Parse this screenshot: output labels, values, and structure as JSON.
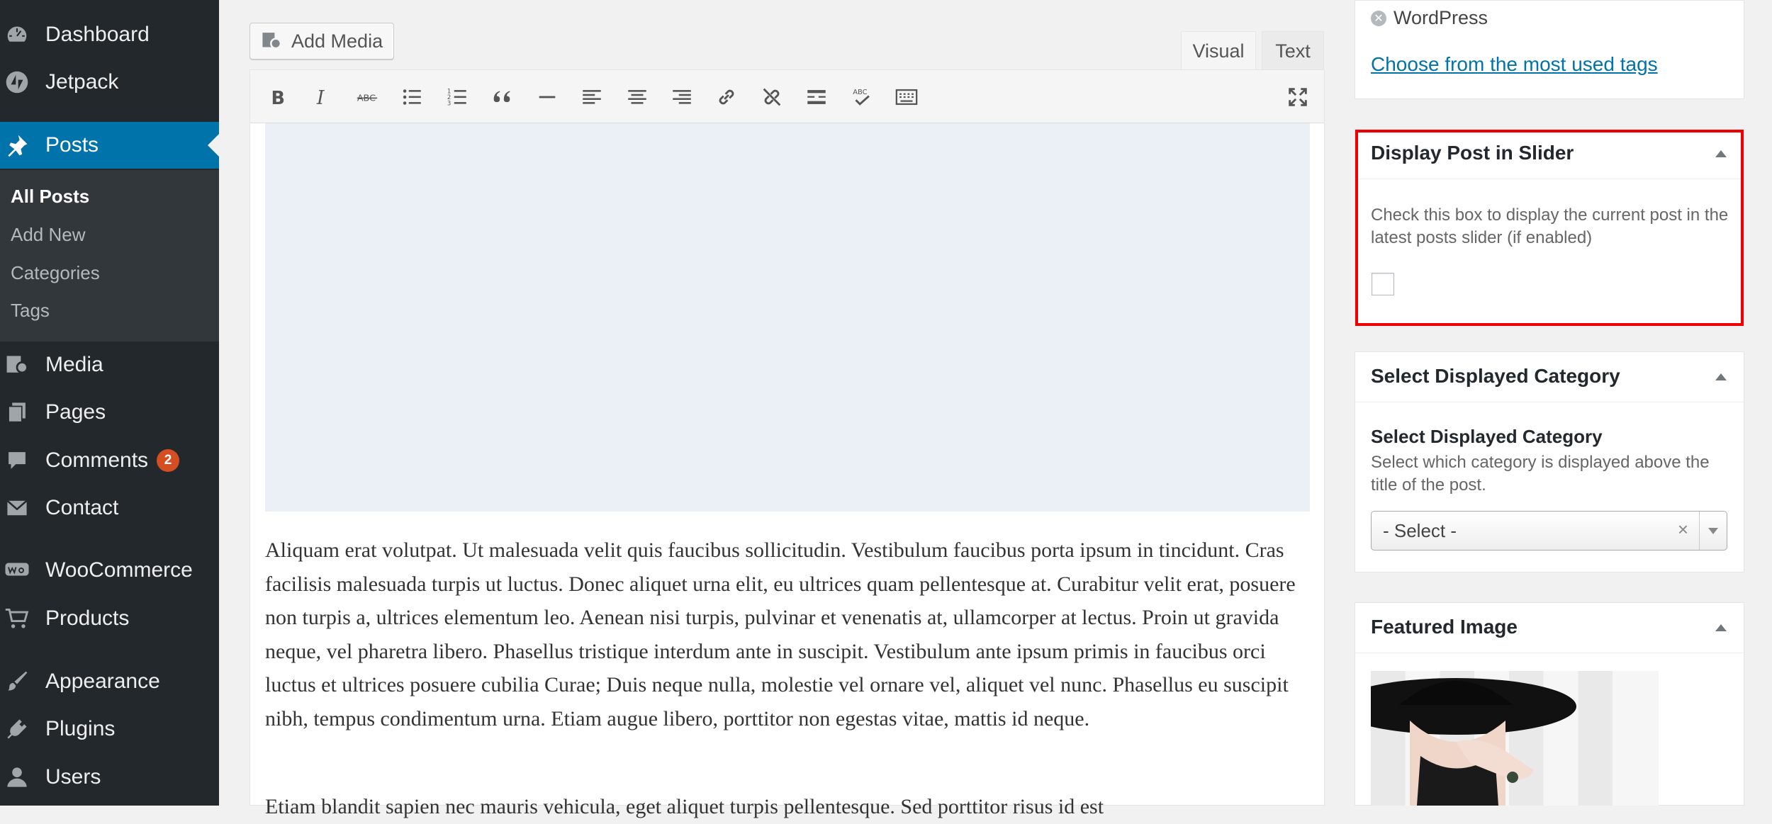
{
  "sidebar": {
    "items": [
      {
        "label": "Dashboard",
        "icon": "dashboard-icon"
      },
      {
        "label": "Jetpack",
        "icon": "jetpack-icon"
      },
      {
        "label": "Posts",
        "icon": "pin-icon",
        "active": true
      },
      {
        "label": "Media",
        "icon": "media-icon"
      },
      {
        "label": "Pages",
        "icon": "pages-icon"
      },
      {
        "label": "Comments",
        "icon": "comments-icon",
        "badge": "2"
      },
      {
        "label": "Contact",
        "icon": "mail-icon"
      },
      {
        "label": "WooCommerce",
        "icon": "woocommerce-icon"
      },
      {
        "label": "Products",
        "icon": "cart-icon"
      },
      {
        "label": "Appearance",
        "icon": "paintbrush-icon"
      },
      {
        "label": "Plugins",
        "icon": "plugin-icon"
      },
      {
        "label": "Users",
        "icon": "user-icon"
      }
    ],
    "submenu": [
      "All Posts",
      "Add New",
      "Categories",
      "Tags"
    ],
    "colors": {
      "background": "#23282d",
      "submenu_bg": "#32373c",
      "active": "#0073aa",
      "badge": "#d54e21"
    }
  },
  "editor": {
    "add_media_label": "Add Media",
    "tabs": {
      "visual": "Visual",
      "text": "Text"
    },
    "toolbar_icons": [
      "bold-icon",
      "italic-icon",
      "strikethrough-icon",
      "bullet-list-icon",
      "numbered-list-icon",
      "blockquote-icon",
      "horizontal-rule-icon",
      "align-left-icon",
      "align-center-icon",
      "align-right-icon",
      "link-icon",
      "unlink-icon",
      "read-more-icon",
      "spellcheck-icon",
      "toolbar-toggle-icon",
      "fullscreen-icon"
    ],
    "paragraphs": [
      "Aliquam erat volutpat. Ut malesuada velit quis faucibus sollicitudin. Vestibulum faucibus porta ipsum in tincidunt. Cras facilisis malesuada turpis ut luctus. Donec aliquet urna elit, eu ultrices quam pellentesque at. Curabitur velit erat, posuere non turpis a, ultrices elementum leo. Aenean nisi turpis, pulvinar et venenatis at, ullamcorper at lectus. Proin ut gravida neque, vel pharetra libero. Phasellus tristique interdum ante in suscipit. Vestibulum ante ipsum primis in faucibus orci luctus et ultrices posuere cubilia Curae; Duis neque nulla, molestie vel ornare vel, aliquet vel nunc. Phasellus eu suscipit nibh, tempus condimentum urna. Etiam augue libero, porttitor non egestas vitae, mattis id neque.",
      "Etiam blandit sapien nec mauris vehicula, eget aliquet turpis pellentesque. Sed porttitor risus id est"
    ]
  },
  "tags_box": {
    "tag": "WordPress",
    "choose_link": "Choose from the most used tags"
  },
  "slider_box": {
    "title": "Display Post in Slider",
    "description": "Check this box to display the current post in the latest posts slider (if enabled)",
    "checked": false,
    "highlight_color": "#ee0000"
  },
  "category_box": {
    "title": "Select Displayed Category",
    "field_label": "Select Displayed Category",
    "description": "Select which category is displayed above the title of the post.",
    "select_value": "- Select -",
    "clear_glyph": "×"
  },
  "featured_box": {
    "title": "Featured Image"
  }
}
